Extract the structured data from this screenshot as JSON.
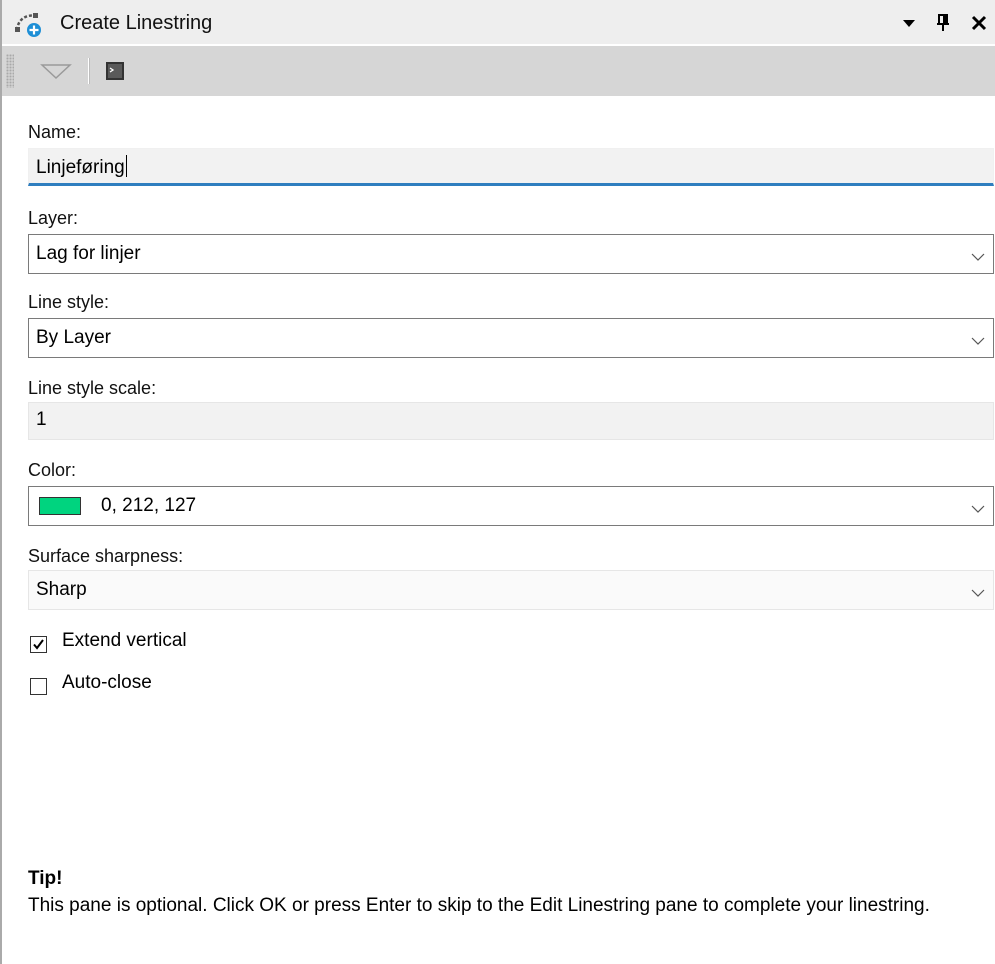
{
  "header": {
    "title": "Create Linestring",
    "icon": "create-linestring-icon",
    "dropdown_icon": "triangle-down-icon",
    "pin_icon": "pin-icon",
    "close_icon": "close-icon"
  },
  "toolbar": {
    "dropdown_icon": "triangle-dropdown-icon",
    "console_icon": "console-icon"
  },
  "form": {
    "name": {
      "label": "Name:",
      "value": "Linjeføring"
    },
    "layer": {
      "label": "Layer:",
      "value": "Lag for linjer"
    },
    "line_style": {
      "label": "Line style:",
      "value": "By Layer"
    },
    "line_style_scale": {
      "label": "Line style scale:",
      "value": "1"
    },
    "color": {
      "label": "Color:",
      "value": "0, 212, 127",
      "swatch_hex": "#00d47f"
    },
    "surface_sharpness": {
      "label": "Surface sharpness:",
      "value": "Sharp"
    },
    "extend_vertical": {
      "label": "Extend vertical",
      "checked": true
    },
    "auto_close": {
      "label": "Auto-close",
      "checked": false
    }
  },
  "tip": {
    "title": "Tip!",
    "text": "This pane is optional. Click OK or press Enter to skip to the Edit Linestring pane to complete your linestring."
  },
  "colors": {
    "focus_underline": "#2f7ebf",
    "toolbar_bg": "#d6d6d6",
    "titlebar_bg": "#eeeeee"
  }
}
